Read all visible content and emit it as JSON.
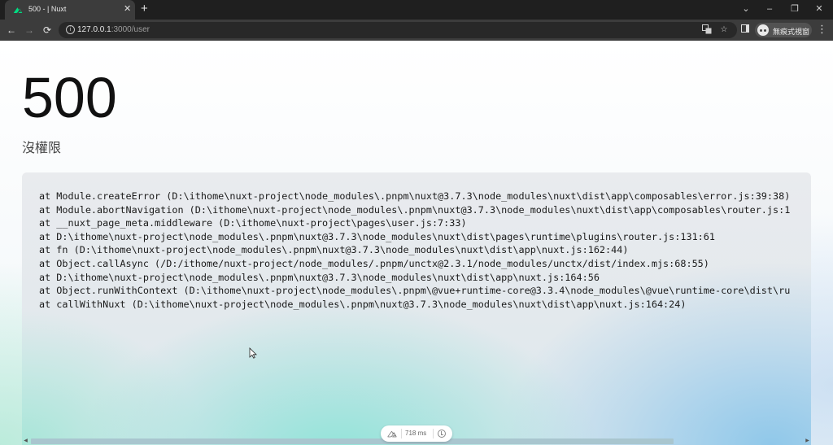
{
  "browser": {
    "tab": {
      "title": "500 - | Nuxt",
      "close_label": "✕"
    },
    "new_tab_label": "+",
    "window_controls": {
      "dropdown": "⌄",
      "minimize": "–",
      "restore": "❐",
      "close": "✕"
    },
    "nav": {
      "back": "←",
      "forward": "→",
      "reload": "⟳"
    },
    "address": {
      "host": "127.0.0.1",
      "path": ":3000/user"
    },
    "icons": {
      "translate": "translate-icon",
      "bookmark": "☆",
      "side_panel": "side-panel-icon",
      "menu": "⋮"
    },
    "profile": {
      "label": "無痕式視窗"
    }
  },
  "error": {
    "status_code": "500",
    "message": "沒權限"
  },
  "stack": [
    "at Module.createError (D:\\ithome\\nuxt-project\\node_modules\\.pnpm\\nuxt@3.7.3\\node_modules\\nuxt\\dist\\app\\composables\\error.js:39:38)",
    "at Module.abortNavigation (D:\\ithome\\nuxt-project\\node_modules\\.pnpm\\nuxt@3.7.3\\node_modules\\nuxt\\dist\\app\\composables\\router.js:1",
    "at __nuxt_page_meta.middleware (D:\\ithome\\nuxt-project\\pages\\user.js:7:33)",
    "at D:\\ithome\\nuxt-project\\node_modules\\.pnpm\\nuxt@3.7.3\\node_modules\\nuxt\\dist\\pages\\runtime\\plugins\\router.js:131:61",
    "at fn (D:\\ithome\\nuxt-project\\node_modules\\.pnpm\\nuxt@3.7.3\\node_modules\\nuxt\\dist\\app\\nuxt.js:162:44)",
    "at Object.callAsync (/D:/ithome/nuxt-project/node_modules/.pnpm/unctx@2.3.1/node_modules/unctx/dist/index.mjs:68:55)",
    "at D:\\ithome\\nuxt-project\\node_modules\\.pnpm\\nuxt@3.7.3\\node_modules\\nuxt\\dist\\app\\nuxt.js:164:56",
    "at Object.runWithContext (D:\\ithome\\nuxt-project\\node_modules\\.pnpm\\@vue+runtime-core@3.3.4\\node_modules\\@vue\\runtime-core\\dist\\ru",
    "at callWithNuxt (D:\\ithome\\nuxt-project\\node_modules\\.pnpm\\nuxt@3.7.3\\node_modules\\nuxt\\dist\\app\\nuxt.js:164:24)"
  ],
  "devtools": {
    "render_time": "718 ms"
  },
  "colors": {
    "nuxt_green": "#00dc82",
    "chrome_dark": "#3c3c3c"
  }
}
